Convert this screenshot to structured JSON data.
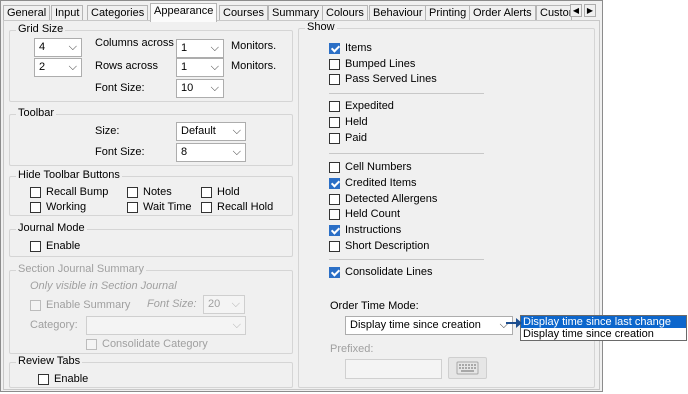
{
  "tabs": [
    {
      "label": "General"
    },
    {
      "label": "Input"
    },
    {
      "label": "Categories"
    },
    {
      "label": "Appearance"
    },
    {
      "label": "Courses"
    },
    {
      "label": "Summary"
    },
    {
      "label": "Colours"
    },
    {
      "label": "Behaviour"
    },
    {
      "label": "Printing"
    },
    {
      "label": "Order Alerts"
    },
    {
      "label": "Custor"
    }
  ],
  "tab_scroll": {
    "left": "◀",
    "right": "▶"
  },
  "grid_size": {
    "title": "Grid Size",
    "columns_value": "4",
    "columns_across_label": "Columns across",
    "columns_monitors_value": "1",
    "monitors_label_1": "Monitors.",
    "rows_value": "2",
    "rows_across_label": "Rows across",
    "rows_monitors_value": "1",
    "monitors_label_2": "Monitors.",
    "font_size_label": "Font Size:",
    "font_size_value": "10"
  },
  "toolbar": {
    "title": "Toolbar",
    "size_label": "Size:",
    "size_value": "Default",
    "font_size_label": "Font Size:",
    "font_size_value": "8"
  },
  "hide_toolbar_buttons": {
    "title": "Hide Toolbar Buttons",
    "recall_bump": "Recall Bump",
    "notes": "Notes",
    "hold": "Hold",
    "working": "Working",
    "wait_time": "Wait Time",
    "recall_hold": "Recall Hold"
  },
  "journal_mode": {
    "title": "Journal Mode",
    "enable": "Enable"
  },
  "section_journal_summary": {
    "title": "Section Journal Summary",
    "note": "Only visible in Section Journal",
    "enable_summary": "Enable Summary",
    "font_size_label": "Font Size:",
    "font_size_value": "20",
    "category_label": "Category:",
    "category_value": "",
    "consolidate_category": "Consolidate Category"
  },
  "review_tabs": {
    "title": "Review Tabs",
    "enable": "Enable"
  },
  "show": {
    "title": "Show",
    "items": [
      {
        "label": "Items",
        "checked": true
      },
      {
        "label": "Bumped Lines",
        "checked": false
      },
      {
        "label": "Pass Served Lines",
        "checked": false
      },
      {
        "label": "Expedited",
        "checked": false
      },
      {
        "label": "Held",
        "checked": false
      },
      {
        "label": "Paid",
        "checked": false
      },
      {
        "label": "Cell Numbers",
        "checked": false
      },
      {
        "label": "Credited Items",
        "checked": true
      },
      {
        "label": "Detected Allergens",
        "checked": false
      },
      {
        "label": "Held Count",
        "checked": false
      },
      {
        "label": "Instructions",
        "checked": true
      },
      {
        "label": "Short Description",
        "checked": false
      },
      {
        "label": "Consolidate Lines",
        "checked": true
      }
    ],
    "order_time_mode_label": "Order Time Mode:",
    "order_time_mode_value": "Display time since creation",
    "prefixed_label": "Prefixed:"
  },
  "dropdown_options": [
    {
      "label": "Display time since last change",
      "highlighted": true
    },
    {
      "label": "Display time since creation",
      "highlighted": false
    }
  ],
  "icons": {
    "combo_arrow": "⌵",
    "keyboard": "keyboard-icon"
  },
  "colors": {
    "highlight": "#0c66cc",
    "check": "#2b6fc6"
  }
}
